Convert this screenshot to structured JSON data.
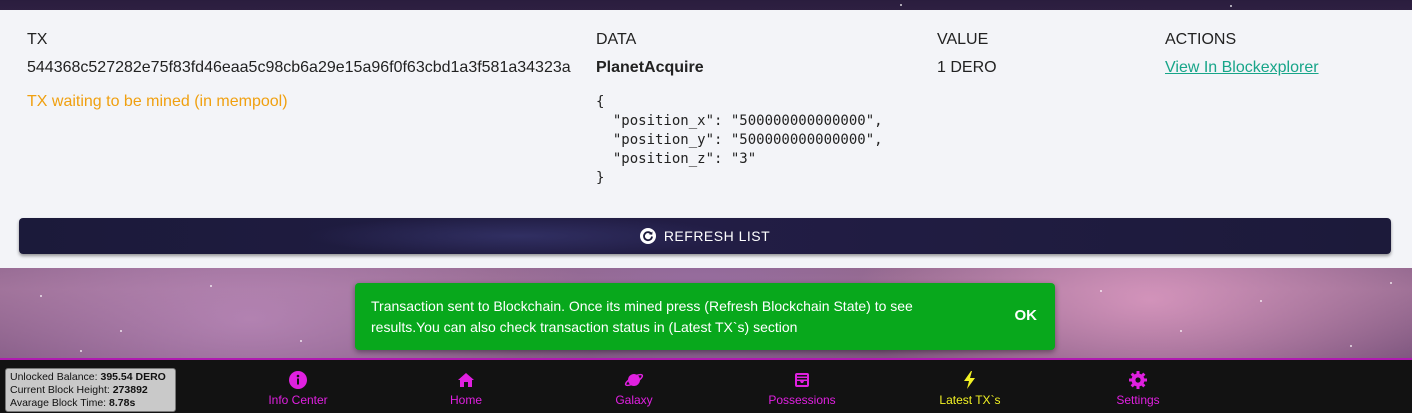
{
  "tx_table": {
    "headers": {
      "tx": "TX",
      "data": "DATA",
      "value": "VALUE",
      "actions": "ACTIONS"
    },
    "row": {
      "tx_hash": "544368c527282e75f83fd46eaa5c98cb6a29e15a96f0f63cbd1a3f581a34323a",
      "status": "TX waiting to be mined (in mempool)",
      "data_title": "PlanetAcquire",
      "data_json": "{\n  \"position_x\": \"500000000000000\",\n  \"position_y\": \"500000000000000\",\n  \"position_z\": \"3\"\n}",
      "value": "1 DERO",
      "action_link": "View In Blockexplorer"
    }
  },
  "refresh_button": {
    "label": "REFRESH LIST",
    "icon": "refresh-icon"
  },
  "toast": {
    "message": "Transaction sent to Blockchain. Once its mined press (Refresh Blockchain State) to see results.You can also check transaction status in (Latest TX`s) section",
    "ok_label": "OK",
    "color": "#08a81c"
  },
  "status_box": {
    "balance_label": "Unlocked Balance:",
    "balance_value": "395.54 DERO",
    "height_label": "Current Block Height:",
    "height_value": "273892",
    "time_label": "Avarage Block Time:",
    "time_value": "8.78s"
  },
  "nav": {
    "items": [
      {
        "label": "Info Center",
        "icon": "info-icon"
      },
      {
        "label": "Home",
        "icon": "home-icon"
      },
      {
        "label": "Galaxy",
        "icon": "planet-icon"
      },
      {
        "label": "Possessions",
        "icon": "inbox-icon"
      },
      {
        "label": "Latest TX`s",
        "icon": "lightning-icon",
        "active": true
      },
      {
        "label": "Settings",
        "icon": "gear-icon"
      }
    ],
    "accent_color": "#e020e0",
    "active_color": "#f2f224"
  }
}
